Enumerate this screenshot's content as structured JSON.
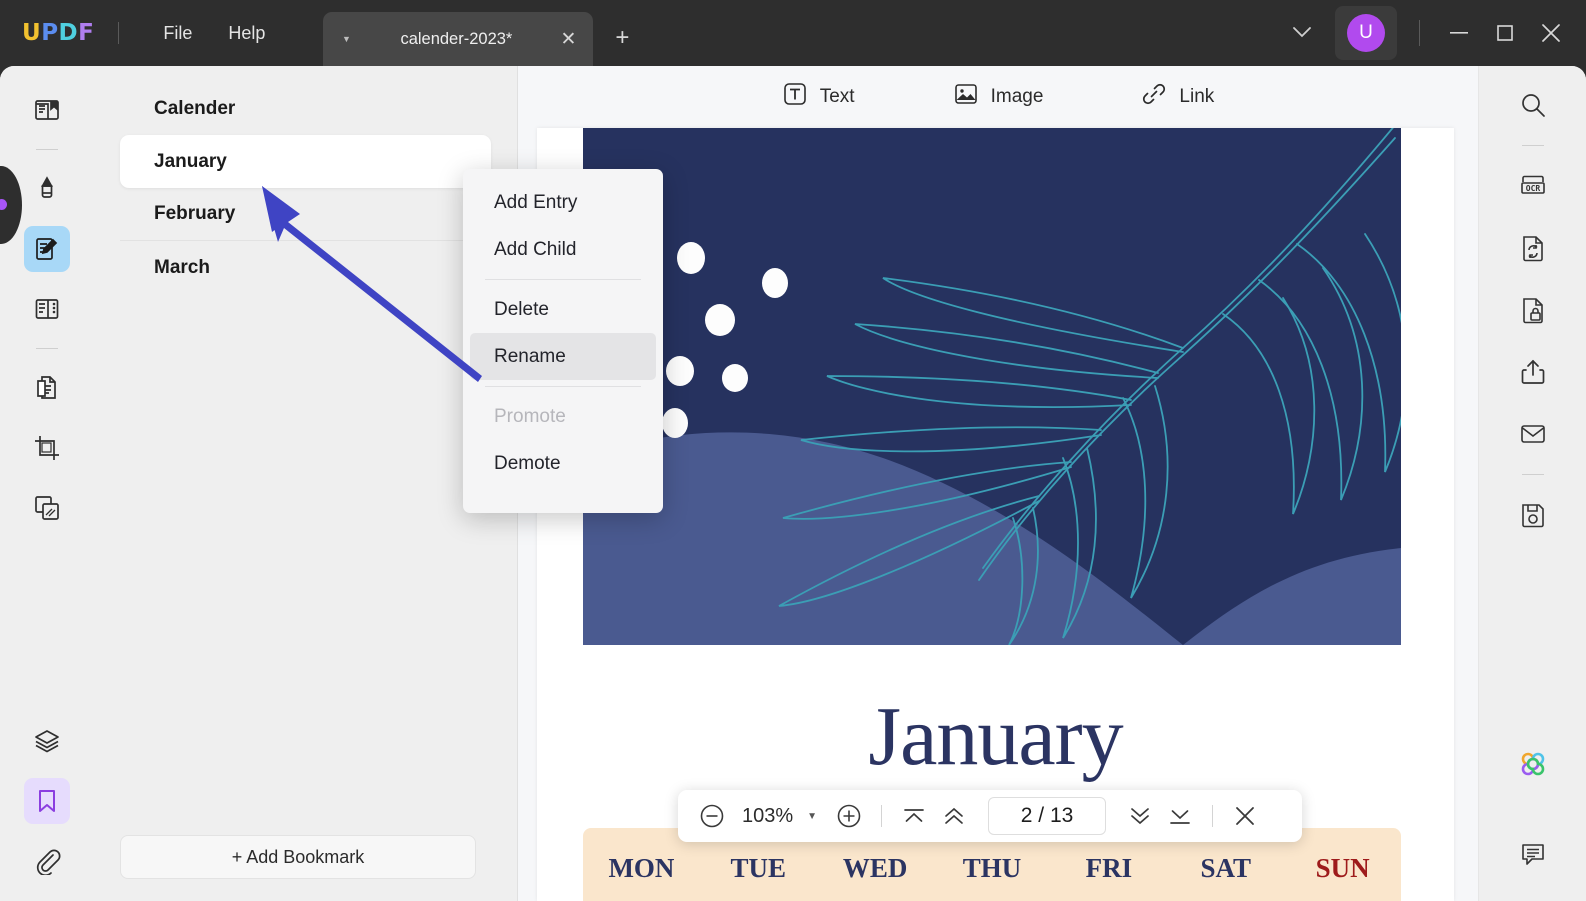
{
  "titlebar": {
    "logo_letters": [
      {
        "ch": "U",
        "color": "#f2c230"
      },
      {
        "ch": "P",
        "color": "#5b8def"
      },
      {
        "ch": "D",
        "color": "#4fd0e0"
      },
      {
        "ch": "F",
        "color": "#b07ef0"
      }
    ],
    "menus": [
      "File",
      "Help"
    ],
    "tab": {
      "title": "calender-2023*",
      "caret_icon": "chevron-down-icon",
      "close_icon": "close-icon"
    },
    "new_tab_label": "+",
    "avatar_initial": "U",
    "avatar_color": "#b14aee",
    "window_controls": [
      "minimize",
      "maximize",
      "close"
    ]
  },
  "left_rail": {
    "tools": [
      {
        "name": "reader-tool",
        "label": "Reader"
      },
      {
        "name": "annotate-tool",
        "label": "Comment"
      },
      {
        "name": "edit-pdf-tool",
        "label": "Edit PDF",
        "selected": true
      },
      {
        "name": "organize-pages-tool",
        "label": "Organize Pages"
      },
      {
        "name": "convert-pdf-tool",
        "label": "Convert PDF"
      },
      {
        "name": "crop-page-tool",
        "label": "Crop"
      },
      {
        "name": "batch-tool",
        "label": "Batch"
      }
    ],
    "bottom_tools": [
      {
        "name": "layers-tool",
        "label": "Layers"
      },
      {
        "name": "bookmark-tool",
        "label": "Bookmark",
        "selected": true
      },
      {
        "name": "attachment-tool",
        "label": "Attachment"
      }
    ]
  },
  "bookmark_panel": {
    "items": [
      {
        "label": "Calender",
        "active": false
      },
      {
        "label": "January",
        "active": true
      },
      {
        "label": "February",
        "active": false
      },
      {
        "label": "March",
        "active": false
      }
    ],
    "add_button_label": "+ Add Bookmark"
  },
  "edit_toolbar": {
    "buttons": [
      {
        "label": "Text",
        "icon": "text-box-icon"
      },
      {
        "label": "Image",
        "icon": "image-icon"
      },
      {
        "label": "Link",
        "icon": "link-icon"
      }
    ]
  },
  "context_menu": {
    "items": [
      {
        "label": "Add Entry",
        "state": "normal"
      },
      {
        "label": "Add Child",
        "state": "normal"
      },
      {
        "separator": true
      },
      {
        "label": "Delete",
        "state": "normal"
      },
      {
        "label": "Rename",
        "state": "hover"
      },
      {
        "separator": true
      },
      {
        "label": "Promote",
        "state": "disabled"
      },
      {
        "label": "Demote",
        "state": "normal"
      }
    ]
  },
  "document": {
    "month_title": "January",
    "day_headers": [
      "MON",
      "TUE",
      "WED",
      "THU",
      "FRI",
      "SAT",
      "SUN"
    ],
    "sunday_color": "#9e1b1b",
    "hero_bg_color": "#26325f",
    "hero_wave_color": "#4a5a90",
    "leaf_stroke_color": "#3b9eb5",
    "day_strip_color": "#fae6cc"
  },
  "zoom_bar": {
    "zoom_out_icon": "minus-circle-icon",
    "zoom_level": "103%",
    "dropdown_icon": "chevron-down-icon",
    "zoom_in_icon": "plus-circle-icon",
    "first_page_icon": "first-page-icon",
    "prev_page_icon": "prev-page-icon",
    "page_indicator": "2 / 13",
    "next_page_icon": "next-page-icon",
    "last_page_icon": "last-page-icon",
    "close_icon": "close-icon"
  },
  "right_rail": {
    "tools": [
      {
        "name": "search-tool",
        "label": "Search"
      },
      {
        "name": "ocr-tool",
        "label": "OCR"
      },
      {
        "name": "convert-tool",
        "label": "Convert"
      },
      {
        "name": "protect-tool",
        "label": "Protect"
      },
      {
        "name": "share-tool",
        "label": "Share"
      },
      {
        "name": "email-tool",
        "label": "Email"
      },
      {
        "name": "save-tool",
        "label": "Save"
      }
    ],
    "bottom_tools": [
      {
        "name": "ai-assistant-tool",
        "label": "AI Assistant"
      },
      {
        "name": "comment-tool",
        "label": "Comments"
      }
    ]
  },
  "annotation": {
    "arrow_color": "#3f44c4"
  }
}
